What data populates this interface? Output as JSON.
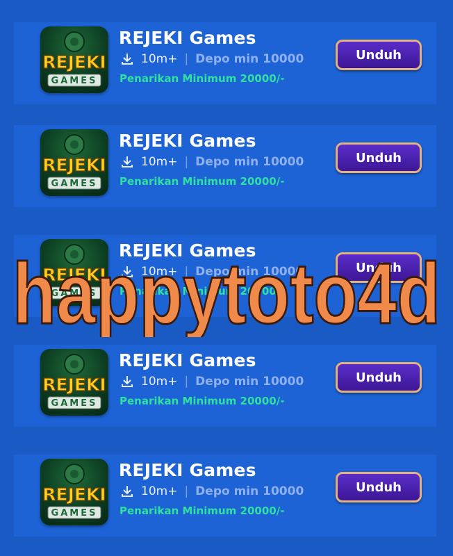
{
  "apps": [
    {
      "title": "REJEKI Games",
      "downloads": "10m+",
      "deposit": "Depo min 10000",
      "withdraw": "Penarikan Minimum 20000/-",
      "button": "Unduh"
    },
    {
      "title": "REJEKI Games",
      "downloads": "10m+",
      "deposit": "Depo min 10000",
      "withdraw": "Penarikan Minimum 20000/-",
      "button": "Unduh"
    },
    {
      "title": "REJEKI Games",
      "downloads": "10m+",
      "deposit": "Depo min 10000",
      "withdraw": "Penarikan Minimum 20000/-",
      "button": "Unduh"
    },
    {
      "title": "REJEKI Games",
      "downloads": "10m+",
      "deposit": "Depo min 10000",
      "withdraw": "Penarikan Minimum 20000/-",
      "button": "Unduh"
    },
    {
      "title": "REJEKI Games",
      "downloads": "10m+",
      "deposit": "Depo min 10000",
      "withdraw": "Penarikan Minimum 20000/-",
      "button": "Unduh"
    }
  ],
  "logo": {
    "line1": "REJEKI",
    "line2": "GAMES"
  },
  "icons": {
    "download": "download-icon"
  },
  "watermark": {
    "text": "happytoto4d"
  },
  "colors": {
    "background": "#1a5ac4",
    "card": "#1d63d6",
    "button": "#4a22b0",
    "button_border": "#e3b27e",
    "withdraw": "#2fe0a0",
    "watermark_fill": "#f08a4b"
  }
}
